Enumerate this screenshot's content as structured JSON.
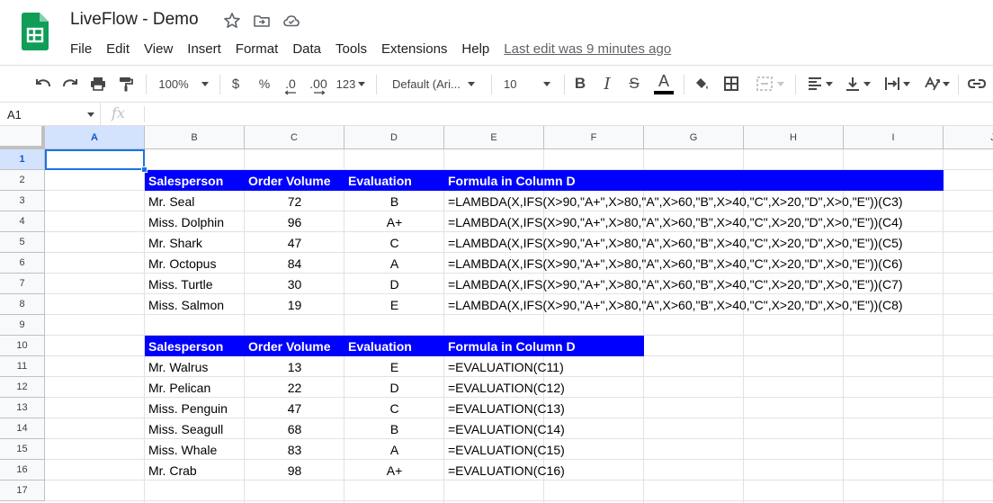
{
  "app": {
    "title": "LiveFlow - Demo",
    "brand_color": "#0f9d58",
    "title_icons": [
      "star-icon",
      "move-to-folder-icon",
      "cloud-saved-icon"
    ]
  },
  "menu": [
    "File",
    "Edit",
    "View",
    "Insert",
    "Format",
    "Data",
    "Tools",
    "Extensions",
    "Help"
  ],
  "last_edit": "Last edit was 9 minutes ago",
  "toolbar": {
    "zoom": "100%",
    "currency": "$",
    "percent": "%",
    "decrease_decimal": ".0",
    "increase_decimal": ".00",
    "more_formats": "123",
    "font": "Default (Ari...",
    "font_size": "10",
    "bold": "B",
    "italic": "I",
    "strike": "S",
    "text_color": "A"
  },
  "formula_bar": {
    "name_box": "A1",
    "fx": "fx",
    "value": ""
  },
  "columns": [
    "A",
    "B",
    "C",
    "D",
    "E",
    "F",
    "G",
    "H",
    "I",
    "J"
  ],
  "rows": [
    "1",
    "2",
    "3",
    "4",
    "5",
    "6",
    "7",
    "8",
    "9",
    "10",
    "11",
    "12",
    "13",
    "14",
    "15",
    "16",
    "17"
  ],
  "selected_cell": "A1",
  "header_band_color": "#0000ff",
  "table1": {
    "headers": [
      "Salesperson",
      "Order Volume",
      "Evaluation",
      "Formula in Column D"
    ],
    "rows": [
      [
        "Mr. Seal",
        "72",
        "B",
        "=LAMBDA(X,IFS(X>90,\"A+\",X>80,\"A\",X>60,\"B\",X>40,\"C\",X>20,\"D\",X>0,\"E\"))(C3)"
      ],
      [
        "Miss. Dolphin",
        "96",
        "A+",
        "=LAMBDA(X,IFS(X>90,\"A+\",X>80,\"A\",X>60,\"B\",X>40,\"C\",X>20,\"D\",X>0,\"E\"))(C4)"
      ],
      [
        "Mr. Shark",
        "47",
        "C",
        "=LAMBDA(X,IFS(X>90,\"A+\",X>80,\"A\",X>60,\"B\",X>40,\"C\",X>20,\"D\",X>0,\"E\"))(C5)"
      ],
      [
        "Mr. Octopus",
        "84",
        "A",
        "=LAMBDA(X,IFS(X>90,\"A+\",X>80,\"A\",X>60,\"B\",X>40,\"C\",X>20,\"D\",X>0,\"E\"))(C6)"
      ],
      [
        "Miss. Turtle",
        "30",
        "D",
        "=LAMBDA(X,IFS(X>90,\"A+\",X>80,\"A\",X>60,\"B\",X>40,\"C\",X>20,\"D\",X>0,\"E\"))(C7)"
      ],
      [
        "Miss. Salmon",
        "19",
        "E",
        "=LAMBDA(X,IFS(X>90,\"A+\",X>80,\"A\",X>60,\"B\",X>40,\"C\",X>20,\"D\",X>0,\"E\"))(C8)"
      ]
    ]
  },
  "table2": {
    "headers": [
      "Salesperson",
      "Order Volume",
      "Evaluation",
      "Formula in Column D"
    ],
    "rows": [
      [
        "Mr. Walrus",
        "13",
        "E",
        "=EVALUATION(C11)"
      ],
      [
        "Mr. Pelican",
        "22",
        "D",
        "=EVALUATION(C12)"
      ],
      [
        "Miss. Penguin",
        "47",
        "C",
        "=EVALUATION(C13)"
      ],
      [
        "Miss. Seagull",
        "68",
        "B",
        "=EVALUATION(C14)"
      ],
      [
        "Miss. Whale",
        "83",
        "A",
        "=EVALUATION(C15)"
      ],
      [
        "Mr. Crab",
        "98",
        "A+",
        "=EVALUATION(C16)"
      ]
    ]
  }
}
